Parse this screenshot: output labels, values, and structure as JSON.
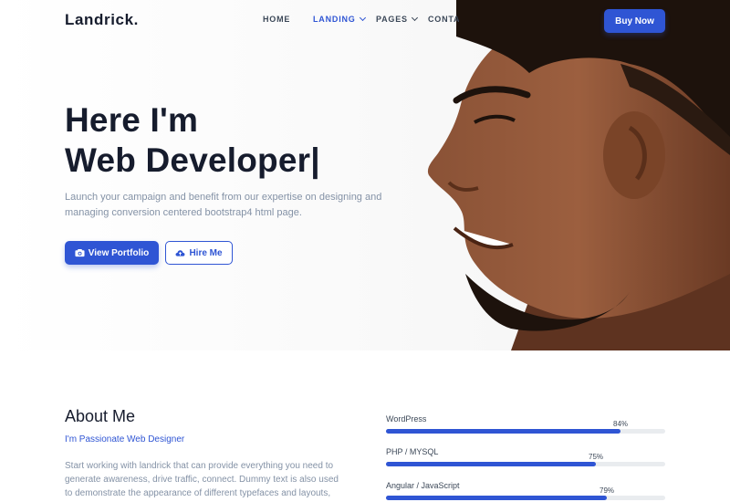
{
  "brand": {
    "logo": "Landrick.",
    "accent": "#2f55d4"
  },
  "nav": {
    "items": [
      {
        "label": "HOME",
        "active": false
      },
      {
        "label": "LANDING",
        "active": true
      },
      {
        "label": "PAGES",
        "active": false
      },
      {
        "label": "CONTACT",
        "active": false
      }
    ],
    "buy_label": "Buy Now"
  },
  "hero": {
    "title_line1": "Here I'm",
    "title_line2": "Web Developer|",
    "description": "Launch your campaign and benefit from our expertise on designing and managing conversion centered bootstrap4 html page.",
    "primary_button": "View Portfolio",
    "primary_icon": "camera-icon",
    "secondary_button": "Hire Me",
    "secondary_icon": "cloud-upload-icon"
  },
  "about": {
    "title": "About Me",
    "subtitle": "I'm Passionate Web Designer",
    "text": "Start working with landrick that can provide everything you need to generate awareness, drive traffic, connect. Dummy text is also used to demonstrate the appearance of different typefaces and layouts, and in"
  },
  "skills": [
    {
      "name": "WordPress",
      "percent_label": "84%",
      "value": 84
    },
    {
      "name": "PHP / MYSQL",
      "percent_label": "75%",
      "value": 75
    },
    {
      "name": "Angular / JavaScript",
      "percent_label": "79%",
      "value": 79
    }
  ]
}
